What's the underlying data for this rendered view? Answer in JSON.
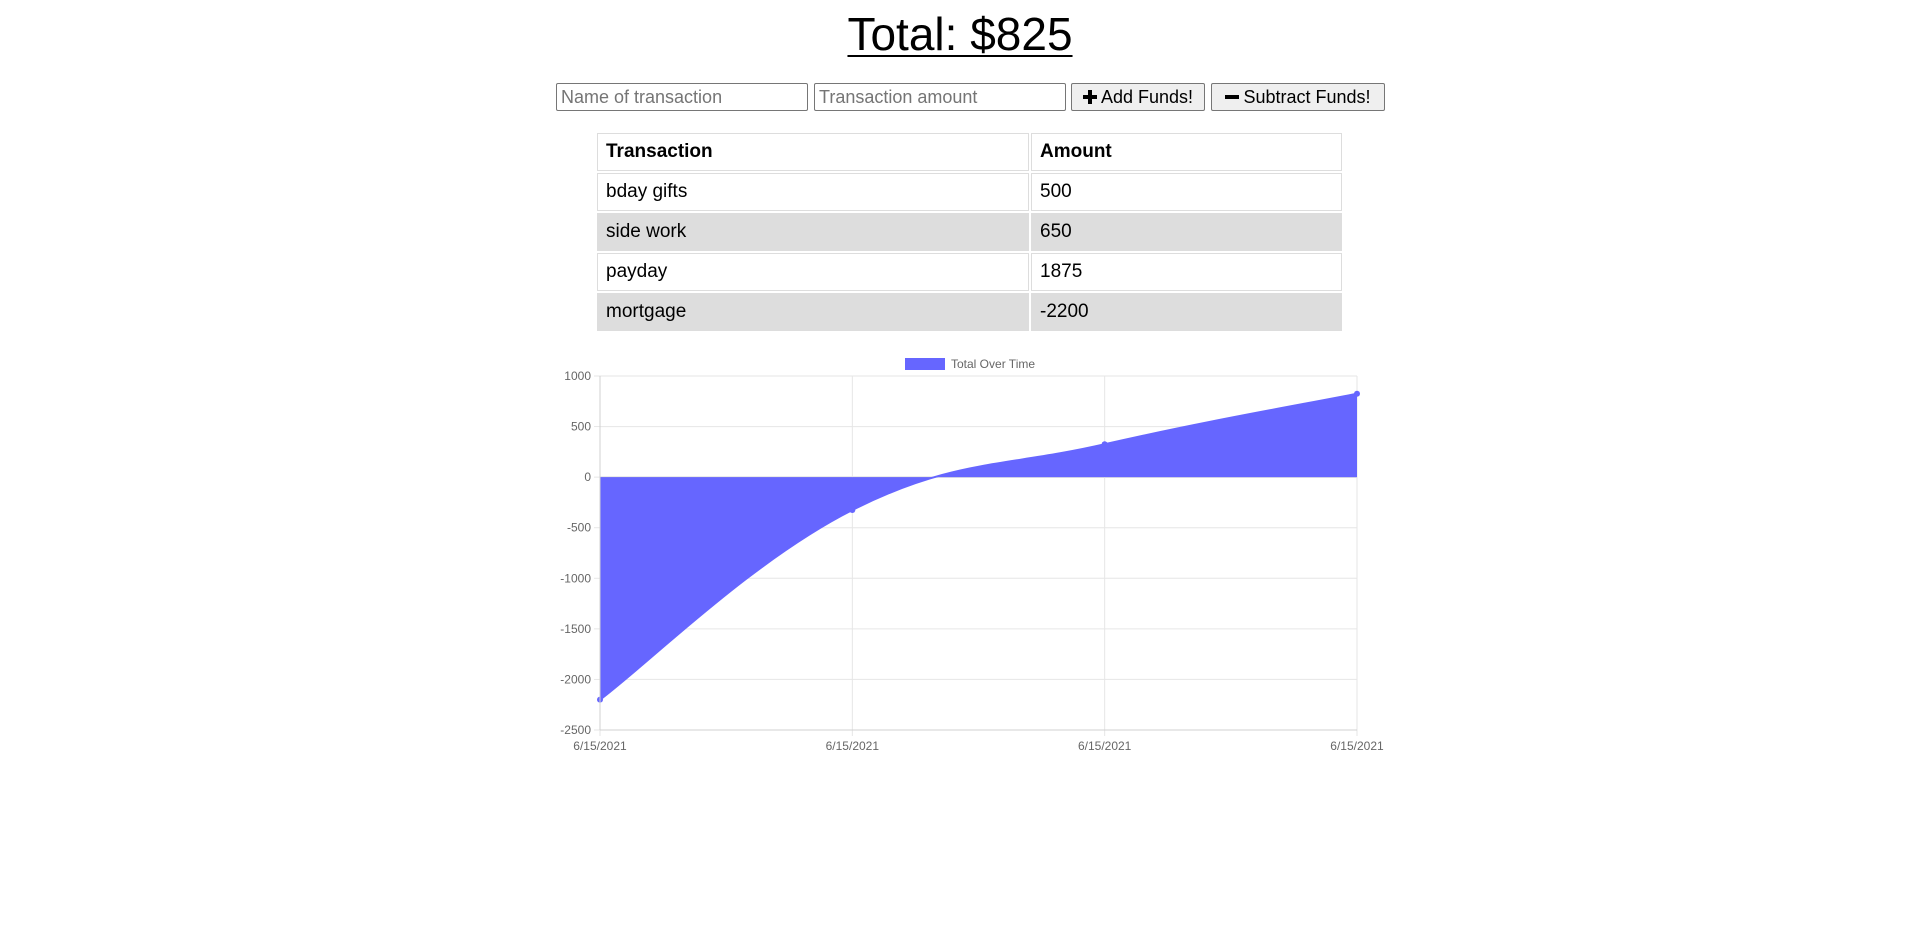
{
  "header": {
    "total_label": "Total: $825"
  },
  "form": {
    "name_placeholder": "Name of transaction",
    "amount_placeholder": "Transaction amount",
    "add_label": "Add Funds!",
    "subtract_label": "Subtract Funds!"
  },
  "table": {
    "headers": [
      "Transaction",
      "Amount"
    ],
    "rows": [
      {
        "name": "bday gifts",
        "amount": "500"
      },
      {
        "name": "side work",
        "amount": "650"
      },
      {
        "name": "payday",
        "amount": "1875"
      },
      {
        "name": "mortgage",
        "amount": "-2200"
      }
    ]
  },
  "chart_data": {
    "type": "area",
    "x": [
      "6/15/2021",
      "6/15/2021",
      "6/15/2021",
      "6/15/2021"
    ],
    "series": [
      {
        "name": "Total Over Time",
        "values": [
          -2200,
          -325,
          325,
          825
        ],
        "color": "#6666ff"
      }
    ],
    "yticks": [
      1000,
      500,
      0,
      -500,
      -1000,
      -1500,
      -2000,
      -2500
    ],
    "ylim": [
      -2500,
      1000
    ],
    "grid": true,
    "legend_position": "top-center"
  }
}
